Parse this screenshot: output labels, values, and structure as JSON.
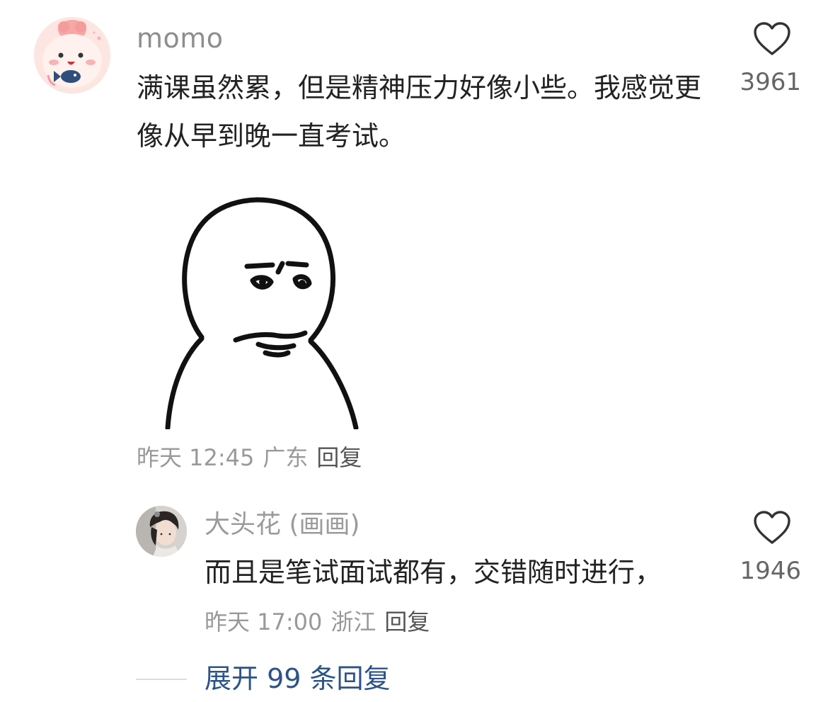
{
  "comment": {
    "username": "momo",
    "text": "满课虽然累，但是精神压力好像小些。我感觉更像从早到晚一直考试。",
    "timestamp": "昨天 12:45",
    "location": "广东",
    "reply_label": "回复",
    "likes": "3961",
    "like_icon": "heart-outline-icon",
    "sticker_icon": "blank-face-meme-sticker"
  },
  "reply": {
    "username": "大头花 (画画)",
    "text": "而且是笔试面试都有，交错随时进行，",
    "timestamp": "昨天 17:00",
    "location": "浙江",
    "reply_label": "回复",
    "likes": "1946",
    "like_icon": "heart-outline-icon"
  },
  "expand": {
    "label": "展开 99 条回复"
  },
  "colors": {
    "link": "#2c5388",
    "meta_text": "#999999",
    "body_text": "#222222",
    "username": "#8e8e8e"
  }
}
